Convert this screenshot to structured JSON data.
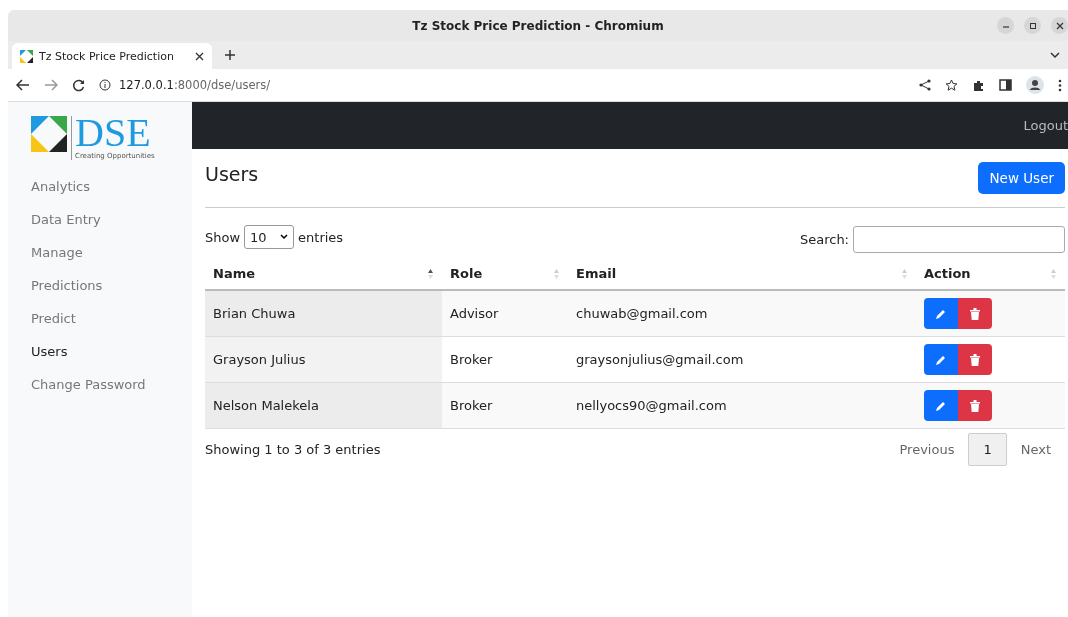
{
  "window": {
    "title": "Tz Stock Price Prediction - Chromium"
  },
  "tabs": [
    {
      "label": "Tz Stock Price Prediction",
      "selected": true
    }
  ],
  "address_bar": {
    "host": "127.0.0.1",
    "path": ":8000/dse/users/"
  },
  "logo": {
    "text": "DSE",
    "tagline": "Creating Opportunities"
  },
  "sidebar": {
    "items": [
      {
        "label": "Analytics",
        "selected": false
      },
      {
        "label": "Data Entry",
        "selected": false
      },
      {
        "label": "Manage",
        "selected": false
      },
      {
        "label": "Predictions",
        "selected": false
      },
      {
        "label": "Predict",
        "selected": false
      },
      {
        "label": "Users",
        "selected": true
      },
      {
        "label": "Change Password",
        "selected": false
      }
    ]
  },
  "navbar": {
    "logout": "Logout"
  },
  "page": {
    "title": "Users",
    "new_button": "New User"
  },
  "table_controls": {
    "show": "Show",
    "page_size": "10",
    "entries": "entries",
    "search_label": "Search:"
  },
  "table": {
    "columns": [
      {
        "label": "Name",
        "sorted": true
      },
      {
        "label": "Role",
        "sorted": false
      },
      {
        "label": "Email",
        "sorted": false
      },
      {
        "label": "Action",
        "sorted": false
      }
    ],
    "rows": [
      {
        "name": "Brian Chuwa",
        "role": "Advisor",
        "email": "chuwab@gmail.com"
      },
      {
        "name": "Grayson Julius",
        "role": "Broker",
        "email": "graysonjulius@gmail.com"
      },
      {
        "name": "Nelson Malekela",
        "role": "Broker",
        "email": "nellyocs90@gmail.com"
      }
    ]
  },
  "footer": {
    "info": "Showing 1 to 3 of 3 entries",
    "previous": "Previous",
    "pages": [
      {
        "label": "1",
        "selected": true
      }
    ],
    "next": "Next"
  }
}
